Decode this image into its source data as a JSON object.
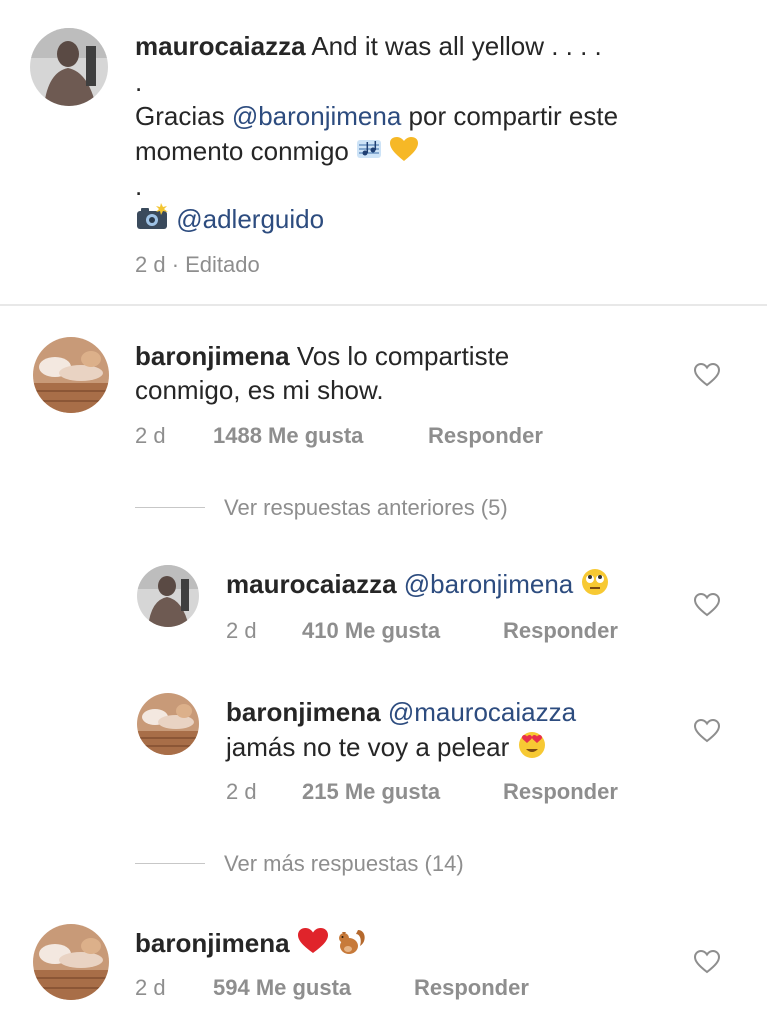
{
  "caption": {
    "username": "maurocaiazza",
    "text": "And it was all yellow . . . .",
    "dot1": ".",
    "gracias": "Gracias",
    "mention": "@baronjimena",
    "rest1": "por compartir este",
    "line3": "momento conmigo",
    "dot2": ".",
    "photo_credit": "@adlerguido",
    "time": "2 d · Editado"
  },
  "comments": [
    {
      "username": "baronjimena",
      "text_line1": "Vos lo compartiste",
      "text_line2": "conmigo, es mi show.",
      "time": "2 d",
      "likes": "1488 Me gusta",
      "reply": "Responder"
    },
    {
      "username": "baronjimena",
      "time": "2 d",
      "likes": "594 Me gusta",
      "reply": "Responder"
    }
  ],
  "view_previous": "Ver respuestas anteriores (5)",
  "view_more": "Ver más respuestas (14)",
  "replies": [
    {
      "username": "maurocaiazza",
      "mention": "@baronjimena",
      "time": "2 d",
      "likes": "410 Me gusta",
      "reply": "Responder"
    },
    {
      "username": "baronjimena",
      "mention": "@maurocaiazza",
      "text_line2": "jamás no te voy a pelear",
      "time": "2 d",
      "likes": "215 Me gusta",
      "reply": "Responder"
    }
  ],
  "colors": {
    "mention": "#2d4c7f",
    "meta": "#8e8e8e",
    "heart_emoji": "#e0242b",
    "yellow_heart": "#f6b826"
  },
  "icons": [
    "heart-outline-icon",
    "music-notes-icon",
    "yellow-heart-icon",
    "camera-flash-icon",
    "eye-roll-emoji-icon",
    "heart-eyes-emoji-icon",
    "red-heart-icon",
    "squirrel-icon"
  ]
}
